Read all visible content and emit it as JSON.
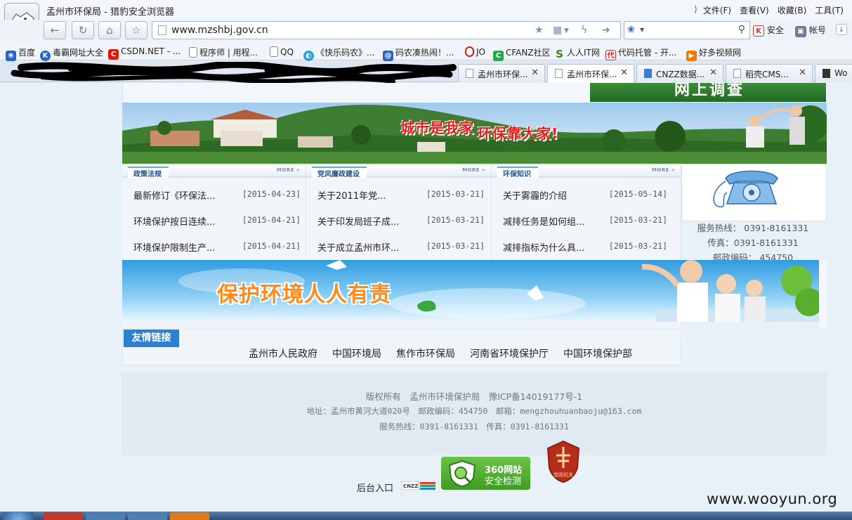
{
  "browser": {
    "window_title": "孟州市环保局 - 猎豹安全浏览器",
    "menu": [
      "文件(F)",
      "查看(V)",
      "收藏(B)",
      "工具(T)"
    ],
    "url": "www.mzshbj.gov.cn",
    "security_label": "安全",
    "account_label": "帐号",
    "bookmarks": [
      {
        "label": "百度",
        "icon": "paw-icon",
        "color": "#2a63c4"
      },
      {
        "label": "毒霸网址大全",
        "icon": "k-logo-icon",
        "color": "#2a63c4"
      },
      {
        "label": "CSDN.NET - ...",
        "icon": "c-logo-icon",
        "color": "#d81e06"
      },
      {
        "label": "程序师 | 用程...",
        "icon": "page-icon",
        "color": "#888888"
      },
      {
        "label": "QQ",
        "icon": "page-icon",
        "color": "#888888"
      },
      {
        "label": "《快乐码农》...",
        "icon": "globe-icon",
        "color": "#2a9fd8"
      },
      {
        "label": "码农凑热闹！...",
        "icon": "swirl-icon",
        "color": "#2a63c4"
      },
      {
        "label": "JO",
        "icon": "opera-icon",
        "color": "#cc1b1b"
      },
      {
        "label": "CFANZ社区",
        "icon": "c-logo-icon",
        "color": "#2ea44f"
      },
      {
        "label": "人人IT网",
        "icon": "s-logo-icon",
        "color": "#3d7f1d"
      },
      {
        "label": "代码托管 - 开...",
        "icon": "code-logo-icon",
        "color": "#cc1b1b"
      },
      {
        "label": "好多视频网",
        "icon": "video-icon",
        "color": "#f07800"
      }
    ],
    "tabs": [
      {
        "label": "孟州市环保...",
        "active": false
      },
      {
        "label": "孟州市环保...",
        "active": true
      },
      {
        "label": "CNZZ数据...",
        "active": false
      },
      {
        "label": "稻壳CMS...",
        "active": false
      },
      {
        "label": "Wo",
        "active": false
      }
    ]
  },
  "page": {
    "banner1": {
      "slogan_part1": "城市是我家",
      "slogan_part2": "环保靠大家!"
    },
    "more_label": "MORE",
    "columns": [
      {
        "title": "政策法规",
        "items": [
          {
            "title": "最新修订《环保法...",
            "date": "[2015-04-23]"
          },
          {
            "title": "环境保护按日连续...",
            "date": "[2015-04-21]"
          },
          {
            "title": "环境保护限制生产...",
            "date": "[2015-04-21]"
          }
        ]
      },
      {
        "title": "党风廉政建设",
        "items": [
          {
            "title": "关于2011年党...",
            "date": "[2015-03-21]"
          },
          {
            "title": "关于印发局班子成...",
            "date": "[2015-03-21]"
          },
          {
            "title": "关于成立孟州市环...",
            "date": "[2015-03-21]"
          }
        ]
      },
      {
        "title": "环保知识",
        "items": [
          {
            "title": "关于雾霾的介绍",
            "date": "[2015-05-14]"
          },
          {
            "title": "减排任务是如何组...",
            "date": "[2015-03-21]"
          },
          {
            "title": "减排指标为什么具...",
            "date": "[2015-03-21]"
          }
        ]
      }
    ],
    "contact": {
      "hotline": "服务热线： 0391-8161331",
      "fax": "传真：0391-8161331",
      "postcode": "邮政编码： 454750"
    },
    "banner2": {
      "slogan": "保护环境人人有责"
    },
    "friend_links": {
      "title": "友情链接",
      "items": [
        "孟州市人民政府",
        "中国环境局",
        "焦作市环保局",
        "河南省环境保护厅",
        "中国环境保护部"
      ]
    },
    "footer": {
      "line1": "版权所有　孟州市环境保护局　豫ICP备14019177号-1",
      "line2": "地址：孟州市黄河大道020号　邮政编码：454750　邮箱：mengzhouhuanbaoju@163.com",
      "line3": "服务热线：0391-8161331　传真：0391-8161331"
    },
    "backend_label": "后台入口",
    "cnzz_label": "CNZZ",
    "badge360": {
      "line1": "360网站",
      "line2": "安全检测"
    },
    "party_badge": "党政机关"
  },
  "watermark": "www.wooyun.org"
}
